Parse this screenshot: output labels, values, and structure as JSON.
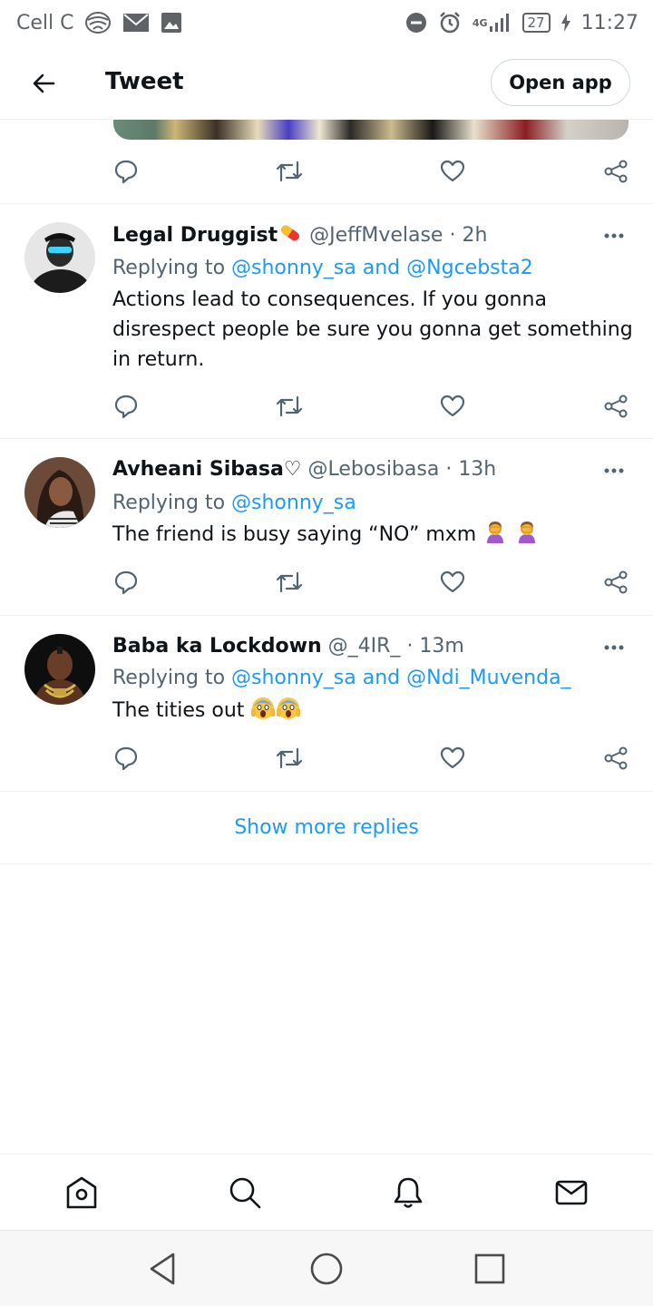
{
  "status_bar": {
    "carrier": "Cell C",
    "network": "4G",
    "battery": "27",
    "time": "11:27",
    "icons": [
      "telkom-logo-icon",
      "mail-icon",
      "image-icon",
      "dnd-icon",
      "alarm-icon",
      "signal-icon",
      "battery-icon",
      "charging-icon"
    ]
  },
  "header": {
    "title": "Tweet",
    "open_app_label": "Open app"
  },
  "tweets": [
    {
      "name": "Legal Druggist",
      "name_emoji": "pill",
      "handle": "@JeffMvelase",
      "time": "· 2h",
      "replying_prefix": "Replying to",
      "mention1": "@shonny_sa",
      "and": "and",
      "mention2": "@Ngcebsta2",
      "text": "Actions lead to consequences. If you gonna disrespect people be sure you gonna get something in return."
    },
    {
      "name": "Avheani Sibasa♡",
      "handle": "@Lebosibasa",
      "time": "· 13h",
      "replying_prefix": "Replying to",
      "mention1": "@shonny_sa",
      "text": "The friend is busy saying “NO” mxm",
      "text_emoji": [
        "woman-facepalming",
        "woman-facepalming"
      ]
    },
    {
      "name": "Baba ka Lockdown",
      "handle": "@_4IR_",
      "time": "· 13m",
      "replying_prefix": "Replying to",
      "mention1": "@shonny_sa",
      "and": "and",
      "mention2": "@Ndi_Muvenda_",
      "text": "The tities out",
      "text_emoji": [
        "face-screaming-in-fear",
        "face-screaming-in-fear"
      ]
    }
  ],
  "show_more_label": "Show more replies",
  "colors": {
    "accent": "#1d9bf0",
    "text": "#0f1419",
    "muted": "#536471",
    "divider": "#eff3f4"
  },
  "bottom_nav": [
    "home-icon",
    "search-icon",
    "notifications-icon",
    "messages-icon"
  ],
  "system_nav": [
    "back-icon",
    "home-circle-icon",
    "recents-icon"
  ]
}
